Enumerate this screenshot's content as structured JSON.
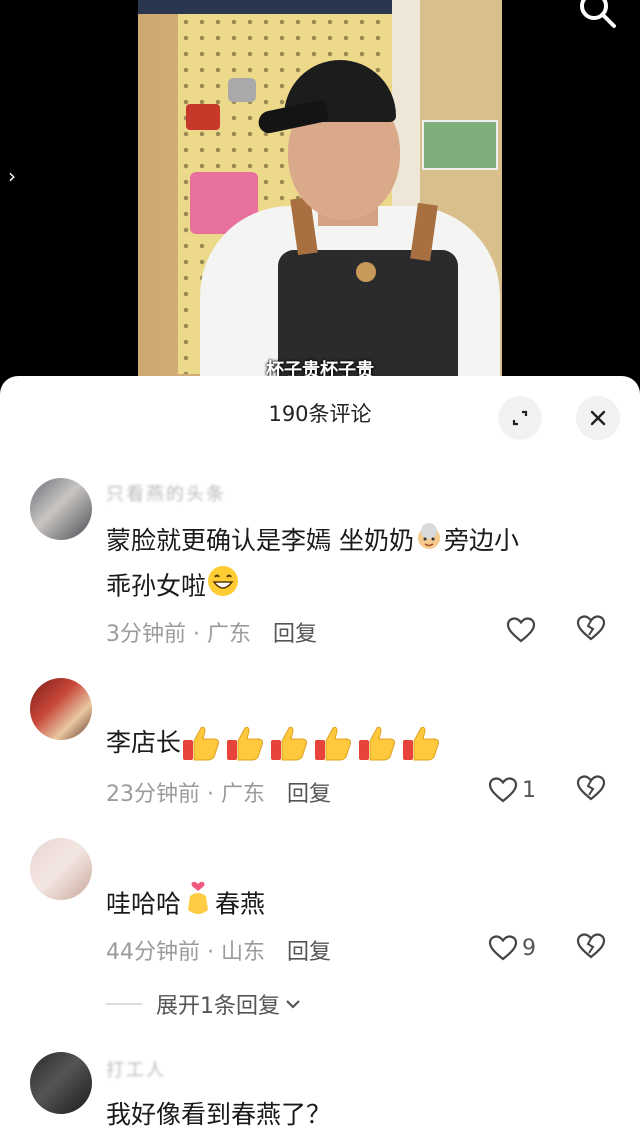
{
  "video": {
    "subtitle": "杯子贵杯子贵",
    "icons": {
      "back": "chevron-right-icon",
      "search": "search-icon"
    }
  },
  "comments_panel": {
    "title": "190条评论",
    "icons": {
      "expand": "expand-icon",
      "close": "close-icon"
    }
  },
  "comments": [
    {
      "user": "只看燕的头条",
      "text_line1": "蒙脸就更确认是李嫣 坐奶奶",
      "text_mid": "旁边小",
      "text_line2": "乖孙女啦",
      "time": "3分钟前",
      "location": "广东",
      "reply_label": "回复",
      "like_count": ""
    },
    {
      "user": "",
      "text": "李店长",
      "thumbs": 6,
      "time": "23分钟前",
      "location": "广东",
      "reply_label": "回复",
      "like_count": "1"
    },
    {
      "user": "",
      "text_before": "哇哈哈",
      "text_after": "春燕",
      "time": "44分钟前",
      "location": "山东",
      "reply_label": "回复",
      "like_count": "9"
    },
    {
      "user": "打工人",
      "text": "我好像看到春燕了？"
    }
  ],
  "expand_replies_label": "展开1条回复",
  "meta_separator": " · "
}
